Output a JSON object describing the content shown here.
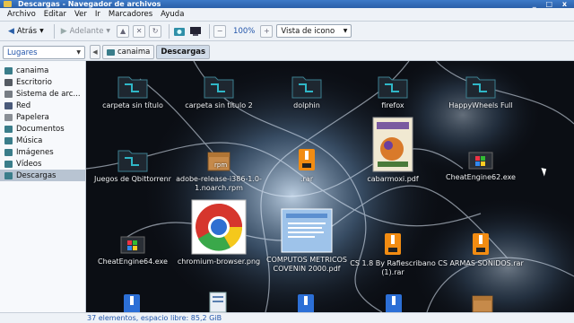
{
  "window": {
    "title": "Descargas - Navegador de archivos",
    "controls": "_ □ x"
  },
  "menu": [
    "Archivo",
    "Editar",
    "Ver",
    "Ir",
    "Marcadores",
    "Ayuda"
  ],
  "toolbar": {
    "back": "Atrás",
    "forward": "Adelante",
    "zoom": "100%",
    "view_mode": "Vista de icono"
  },
  "places": {
    "label": "Lugares",
    "close": "x"
  },
  "breadcrumbs": [
    "canaima",
    "Descargas"
  ],
  "sidebar": {
    "items": [
      {
        "label": "canaima",
        "color": "#3a7d8a"
      },
      {
        "label": "Escritorio",
        "color": "#555b63"
      },
      {
        "label": "Sistema de arc...",
        "color": "#777d85"
      },
      {
        "label": "Red",
        "color": "#4a5a7a"
      },
      {
        "label": "Papelera",
        "color": "#8a8f96"
      },
      {
        "label": "Documentos",
        "color": "#3a7d8a"
      },
      {
        "label": "Música",
        "color": "#3a7d8a"
      },
      {
        "label": "Imágenes",
        "color": "#3a7d8a"
      },
      {
        "label": "Vídeos",
        "color": "#3a7d8a"
      },
      {
        "label": "Descargas",
        "color": "#3a7d8a"
      }
    ],
    "selected": "Descargas"
  },
  "files": [
    {
      "name": "carpeta sin título",
      "icon": "folder-icon"
    },
    {
      "name": "carpeta sin título 2",
      "icon": "folder-icon"
    },
    {
      "name": "dolphin",
      "icon": "folder-icon"
    },
    {
      "name": "firefox",
      "icon": "folder-icon"
    },
    {
      "name": "HappyWheels Full",
      "icon": "folder-icon"
    },
    {
      "name": "Juegos de Qbittorrenr",
      "icon": "folder-icon"
    },
    {
      "name": "adobe-release-i386-1.0-1.noarch.rpm",
      "icon": "package-icon"
    },
    {
      "name": ".rar",
      "icon": "archive-icon"
    },
    {
      "name": "cabarmoxi.pdf",
      "icon": "pdf-thumbnail"
    },
    {
      "name": "CheatEngine62.exe",
      "icon": "exe-icon"
    },
    {
      "name": "CheatEngine64.exe",
      "icon": "exe-icon"
    },
    {
      "name": "chromium-browser.png",
      "icon": "image-thumbnail"
    },
    {
      "name": "COMPUTOS METRICOS COVENIN 2000.pdf",
      "icon": "pdf-thumbnail"
    },
    {
      "name": "CS 1.8 By Rafiescribano (1).rar",
      "icon": "archive-icon"
    },
    {
      "name": "CS ARMAS SONIDOS.rar",
      "icon": "archive-icon"
    }
  ],
  "status": "37 elementos, espacio libre: 85,2 GiB"
}
